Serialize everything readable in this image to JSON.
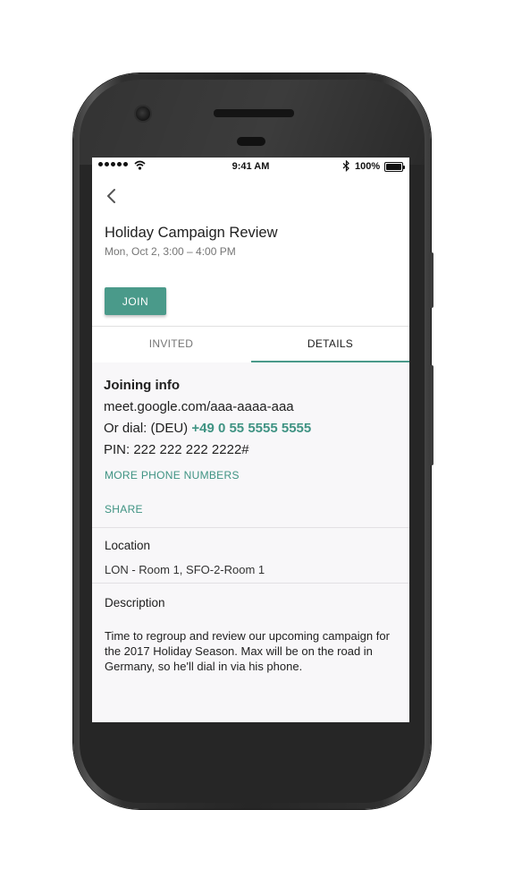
{
  "status_bar": {
    "time": "9:41 AM",
    "battery": "100%",
    "battery_level": 1.0
  },
  "event": {
    "title": "Holiday Campaign Review",
    "datetime": "Mon, Oct 2, 3:00 – 4:00 PM",
    "join_label": "JOIN"
  },
  "tabs": [
    {
      "label": "INVITED",
      "selected": false
    },
    {
      "label": "DETAILS",
      "selected": true
    }
  ],
  "joining_info": {
    "heading": "Joining info",
    "meet_url": "meet.google.com/aaa-aaaa-aaa",
    "dial_prefix": "Or dial: (DEU) ",
    "dial_number": "+49 0 55 5555 5555",
    "pin": "PIN: 222 222 222 2222#",
    "more_phone_numbers": "MORE PHONE NUMBERS",
    "share": "SHARE"
  },
  "location": {
    "label": "Location",
    "value": "LON - Room 1, SFO-2-Room 1"
  },
  "description": {
    "label": "Description",
    "text": "Time to regroup and review our upcoming campaign for the 2017 Holiday Season. Max will be on the road in Germany, so he'll dial in via his phone."
  },
  "colors": {
    "accent": "#4a9a8a",
    "link": "#3f9383",
    "content_background": "#f8f7f9"
  },
  "icons": [
    "signal-icon",
    "wifi-icon",
    "bluetooth-icon",
    "battery-icon",
    "back-arrow-icon"
  ]
}
